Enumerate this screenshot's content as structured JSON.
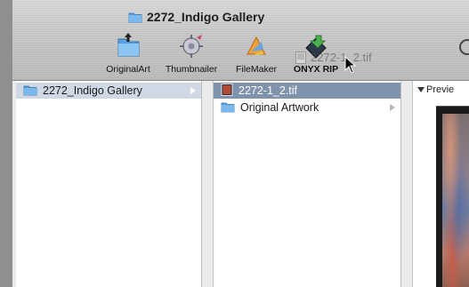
{
  "window": {
    "title": "2272_Indigo Gallery"
  },
  "toolbar": {
    "items": [
      {
        "label": "OriginalArt",
        "icon": "folder-icon"
      },
      {
        "label": "Thumbnailer",
        "icon": "thumbnailer-icon"
      },
      {
        "label": "FileMaker",
        "icon": "filemaker-icon"
      },
      {
        "label": "ONYX RIP",
        "icon": "onyx-rip-icon"
      }
    ],
    "drag_ghost_label": "2272-1_2.tif"
  },
  "columns": {
    "col1": {
      "items": [
        {
          "label": "2272_Indigo Gallery",
          "icon": "folder-icon",
          "selected": true,
          "has_children": true
        }
      ]
    },
    "col2": {
      "items": [
        {
          "label": "2272-1_2.tif",
          "icon": "tif-file-icon",
          "selected": true,
          "has_children": false
        },
        {
          "label": "Original Artwork",
          "icon": "folder-icon",
          "selected": false,
          "has_children": true
        }
      ]
    },
    "preview": {
      "label": "Previe"
    }
  },
  "colors": {
    "selection": "#7f93ad",
    "selection_inactive": "#cfd9e6",
    "folder_blue": "#5aa0e0"
  }
}
